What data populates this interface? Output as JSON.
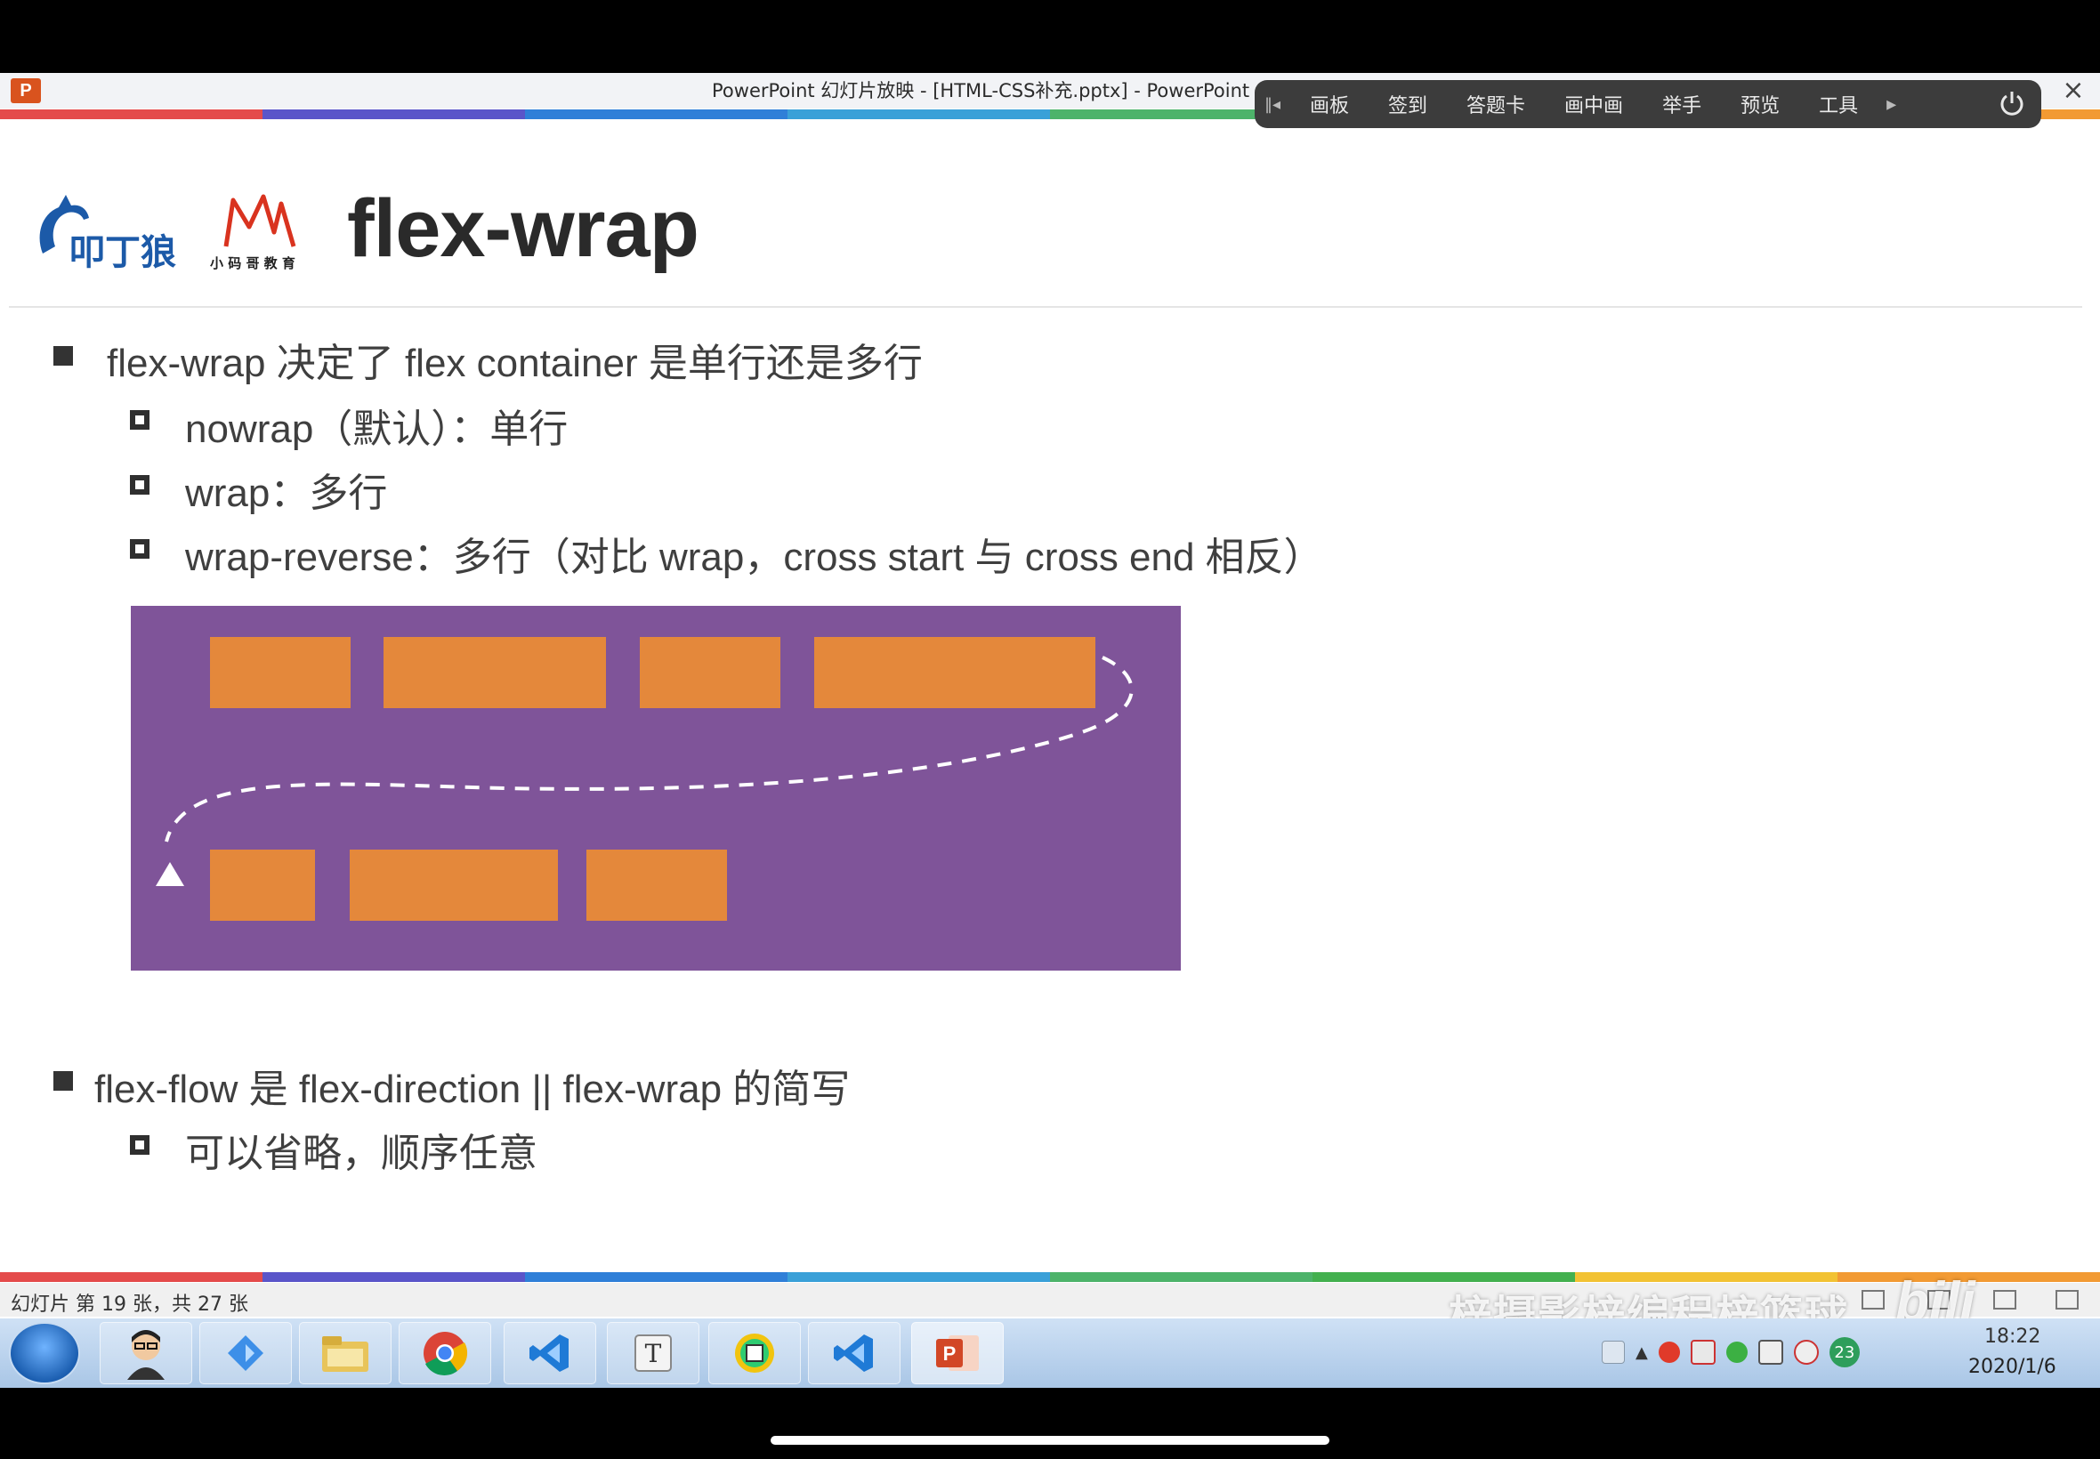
{
  "window": {
    "title": "PowerPoint 幻灯片放映 - [HTML-CSS补充.pptx] - PowerPoint",
    "close_glyph": "×"
  },
  "toolbar": {
    "items": [
      "画板",
      "签到",
      "答题卡",
      "画中画",
      "举手",
      "预览",
      "工具"
    ]
  },
  "slide": {
    "title": "flex-wrap",
    "bullets": [
      {
        "text": "flex-wrap 决定了 flex container 是单行还是多行",
        "children": [
          "nowrap（默认）：单行",
          "wrap：多行",
          "wrap-reverse：多行（对比 wrap，cross start 与 cross end 相反）"
        ]
      },
      {
        "text": "flex-flow 是 flex-direction || flex-wrap 的简写",
        "children": [
          "可以省略，顺序任意"
        ]
      }
    ],
    "diagram": {
      "background": "#7f5499",
      "item_color": "#e4883b"
    }
  },
  "statusbar": {
    "text": "幻灯片 第 19 张，共 27 张",
    "watermark": "梓摄影梓编程梓篮球"
  },
  "taskbar": {
    "apps": [
      "avatar",
      "app-blue",
      "file-explorer",
      "chrome",
      "vscode",
      "typora",
      "app-colorful",
      "vscode-2",
      "powerpoint"
    ],
    "tray_badge": "23",
    "time": "18:22",
    "date": "2020/1/6"
  },
  "colors": {
    "stripe": [
      "#e44b4b",
      "#5a55c9",
      "#2f7fd8",
      "#3aa0d8",
      "#4db36a",
      "#43b04f",
      "#f2c233",
      "#f29a33"
    ]
  }
}
